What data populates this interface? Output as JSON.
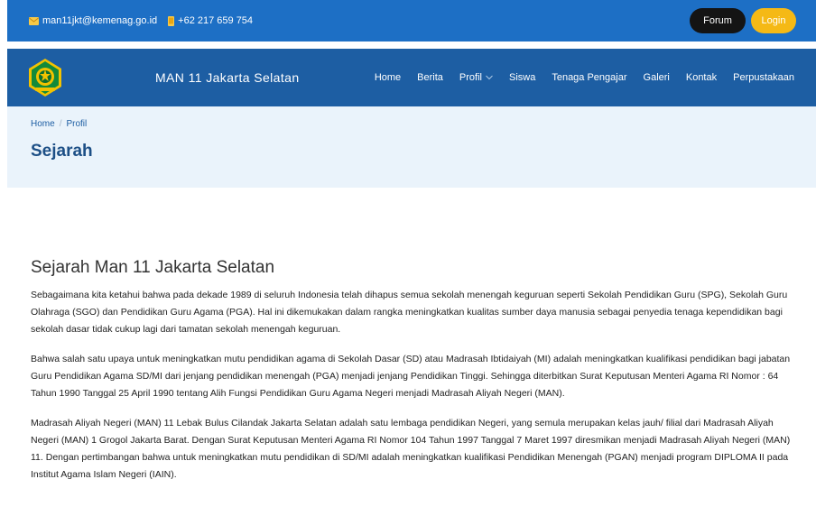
{
  "topbar": {
    "email": "man11jkt@kemenag.go.id",
    "phone": "+62 217 659 754",
    "forum_label": "Forum",
    "login_label": "Login"
  },
  "navbar": {
    "site_title": "MAN 11 Jakarta Selatan",
    "menu": [
      {
        "label": "Home"
      },
      {
        "label": "Berita"
      },
      {
        "label": "Profil"
      },
      {
        "label": "Siswa"
      },
      {
        "label": "Tenaga Pengajar"
      },
      {
        "label": "Galeri"
      },
      {
        "label": "Kontak"
      },
      {
        "label": "Perpustakaan"
      }
    ]
  },
  "breadcrumb": {
    "home": "Home",
    "separator": "/",
    "current": "Profil"
  },
  "page_title": "Sejarah",
  "article": {
    "title": "Sejarah Man 11 Jakarta Selatan",
    "paragraphs": [
      "Sebagaimana kita ketahui bahwa pada dekade 1989 di seluruh Indonesia telah dihapus semua sekolah menengah keguruan seperti Sekolah Pendidikan Guru (SPG), Sekolah Guru Olahraga (SGO) dan Pendidikan Guru Agama (PGA). Hal ini dikemukakan dalam rangka meningkatkan kualitas sumber daya manusia sebagai penyedia tenaga kependidikan bagi sekolah dasar tidak cukup lagi dari tamatan sekolah menengah keguruan.",
      "Bahwa salah satu upaya untuk meningkatkan mutu pendidikan agama di Sekolah Dasar (SD) atau Madrasah Ibtidaiyah (MI) adalah meningkatkan kualifikasi pendidikan bagi jabatan Guru Pendidikan Agama SD/MI dari jenjang pendidikan menengah (PGA) menjadi jenjang Pendidikan Tinggi. Sehingga diterbitkan Surat Keputusan Menteri Agama RI Nomor : 64 Tahun 1990 Tanggal 25 April 1990 tentang Alih Fungsi Pendidikan Guru Agama Negeri menjadi Madrasah Aliyah Negeri (MAN).",
      "Madrasah Aliyah Negeri (MAN) 11 Lebak Bulus Cilandak Jakarta Selatan adalah satu lembaga pendidikan Negeri, yang semula merupakan kelas jauh/ filial dari Madrasah Aliyah Negeri (MAN) 1 Grogol Jakarta Barat. Dengan Surat Keputusan Menteri Agama RI Nomor 104 Tahun 1997 Tanggal 7 Maret 1997 diresmikan menjadi Madrasah Aliyah Negeri (MAN) 11. Dengan pertimbangan bahwa untuk meningkatkan mutu pendidikan di SD/MI adalah meningkatkan kualifikasi Pendidikan Menengah (PGAN) menjadi program DIPLOMA II pada Institut Agama Islam Negeri (IAIN)."
    ]
  },
  "colors": {
    "topbar": "#1d6fc5",
    "navbar": "#1d5ea3",
    "breadcrumb_bg": "#eaf3fb",
    "login": "#f5b915",
    "forum": "#141414"
  }
}
